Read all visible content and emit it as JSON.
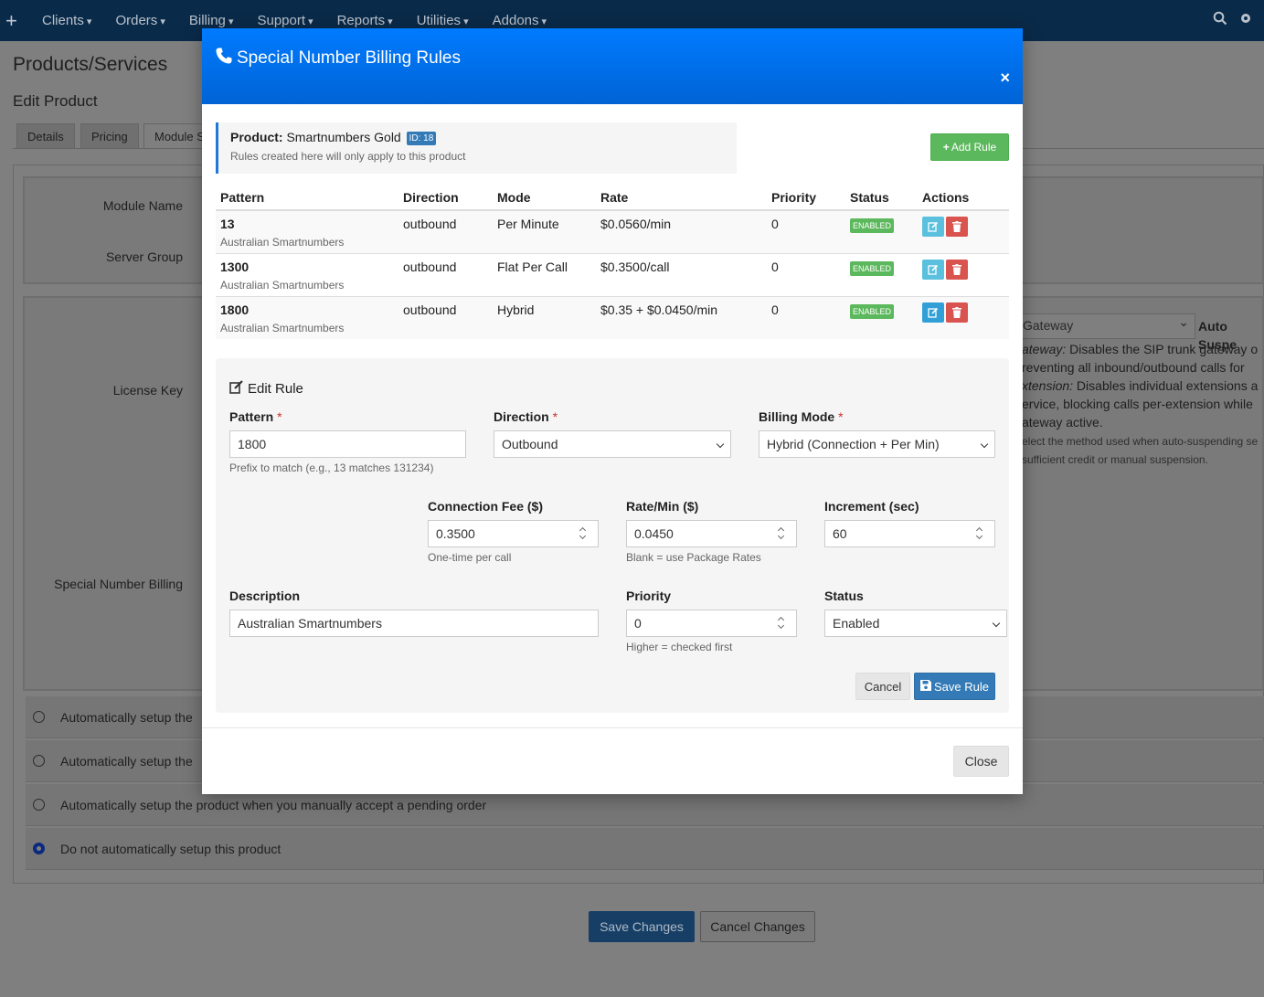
{
  "nav": {
    "items": [
      "Clients",
      "Orders",
      "Billing",
      "Support",
      "Reports",
      "Utilities",
      "Addons"
    ]
  },
  "page": {
    "title": "Products/Services",
    "subtitle": "Edit Product",
    "tabs": [
      "Details",
      "Pricing",
      "Module S"
    ],
    "labels": {
      "module_name": "Module Name",
      "server_group": "Server Group",
      "license_key": "License Key",
      "special_number_billing": "Special Number Billing"
    },
    "right_panel": {
      "select_value": "Gateway",
      "auto_suspend_label": "Auto Suspe",
      "line1_em": "ateway:",
      "line1": " Disables the SIP trunk gateway o",
      "line2": "reventing all inbound/outbound calls for",
      "line3_em": "xtension:",
      "line3": " Disables individual extensions a",
      "line4": "ervice, blocking calls per-extension while",
      "line5": "ateway active.",
      "help1": "elect the method used when auto-suspending se",
      "help2": "sufficient credit or manual suspension."
    },
    "radios": [
      {
        "label": "Automatically setup the",
        "checked": false
      },
      {
        "label": "Automatically setup the",
        "checked": false
      },
      {
        "label": "Automatically setup the product when you manually accept a pending order",
        "checked": false
      },
      {
        "label": "Do not automatically setup this product",
        "checked": true
      }
    ],
    "save_changes": "Save Changes",
    "cancel_changes": "Cancel Changes"
  },
  "modal": {
    "title": "Special Number Billing Rules",
    "close_x": "×",
    "product_label": "Product:",
    "product_name": "Smartnumbers Gold",
    "product_id_badge": "ID: 18",
    "product_note": "Rules created here will only apply to this product",
    "add_rule": "Add Rule",
    "columns": [
      "Pattern",
      "Direction",
      "Mode",
      "Rate",
      "Priority",
      "Status",
      "Actions"
    ],
    "rules": [
      {
        "pattern": "13",
        "description": "Australian Smartnumbers",
        "direction": "outbound",
        "mode": "Per Minute",
        "rate": "$0.0560/min",
        "priority": "0",
        "status": "ENABLED"
      },
      {
        "pattern": "1300",
        "description": "Australian Smartnumbers",
        "direction": "outbound",
        "mode": "Flat Per Call",
        "rate": "$0.3500/call",
        "priority": "0",
        "status": "ENABLED"
      },
      {
        "pattern": "1800",
        "description": "Australian Smartnumbers",
        "direction": "outbound",
        "mode": "Hybrid",
        "rate": "$0.35 + $0.0450/min",
        "priority": "0",
        "status": "ENABLED"
      }
    ],
    "edit": {
      "title": "Edit Rule",
      "pattern_label": "Pattern",
      "pattern_value": "1800",
      "pattern_help": "Prefix to match (e.g., 13 matches 131234)",
      "direction_label": "Direction",
      "direction_value": "Outbound",
      "billing_mode_label": "Billing Mode",
      "billing_mode_value": "Hybrid (Connection + Per Min)",
      "connection_fee_label": "Connection Fee ($)",
      "connection_fee_value": "0.3500",
      "connection_fee_help": "One-time per call",
      "rate_label": "Rate/Min ($)",
      "rate_value": "0.0450",
      "rate_help": "Blank = use Package Rates",
      "increment_label": "Increment (sec)",
      "increment_value": "60",
      "description_label": "Description",
      "description_value": "Australian Smartnumbers",
      "priority_label": "Priority",
      "priority_value": "0",
      "priority_help": "Higher = checked first",
      "status_label": "Status",
      "status_value": "Enabled",
      "required_mark": "*",
      "cancel": "Cancel",
      "save": "Save Rule"
    },
    "close": "Close"
  }
}
